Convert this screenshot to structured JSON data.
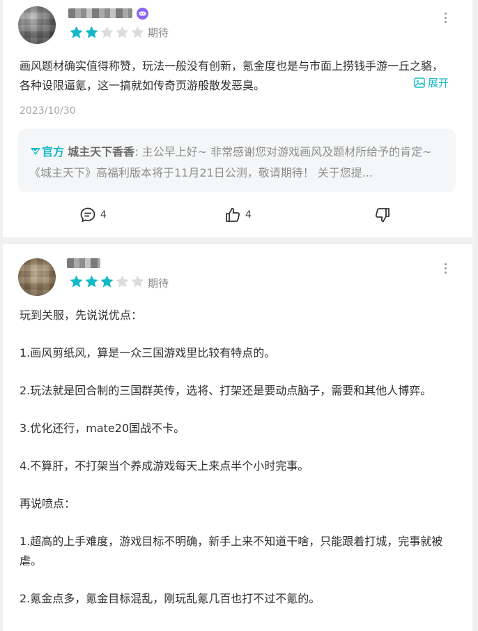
{
  "reviews": [
    {
      "badge_icon": "gamepad-icon",
      "rating": 2,
      "rating_max": 5,
      "status": "期待",
      "content": "画风题材确实值得称赞，玩法一般没有创新，氪金度也是与市面上捞钱手游一丘之貉，各种设限逼氪，这一搞就如传奇页游般散发恶臭。",
      "expand_label": "展开",
      "date": "2023/10/30",
      "reply": {
        "tag": "官方",
        "name": "城主天下香香",
        "text": ": 主公早上好~ 非常感谢您对游戏画风及题材所给予的肯定~《城主天下》高福利版本将于11月21日公测，敬请期待！ 关于您提..."
      },
      "comments": "4",
      "likes": "4"
    },
    {
      "rating": 3,
      "rating_max": 5,
      "status": "期待",
      "paragraphs": [
        "玩到关服，先说说优点：",
        "1.画风剪纸风，算是一众三国游戏里比较有特点的。",
        "2.玩法就是回合制的三国群英传，选将、打架还是要动点脑子，需要和其他人博弈。",
        "3.优化还行，mate20国战不卡。",
        "4.不算肝，不打架当个养成游戏每天上来点半个小时完事。",
        "再说喷点：",
        "1.超高的上手难度，游戏目标不明确，新手上来不知道干啥，只能跟着打城，完事就被虐。",
        "2.氪金点多，氪金目标混乱，刚玩乱氪几百也打不过不氪的。"
      ]
    }
  ],
  "colors": {
    "accent": "#14b9c8",
    "star_empty": "#dcdcdc",
    "badge": "#8a63f2"
  }
}
